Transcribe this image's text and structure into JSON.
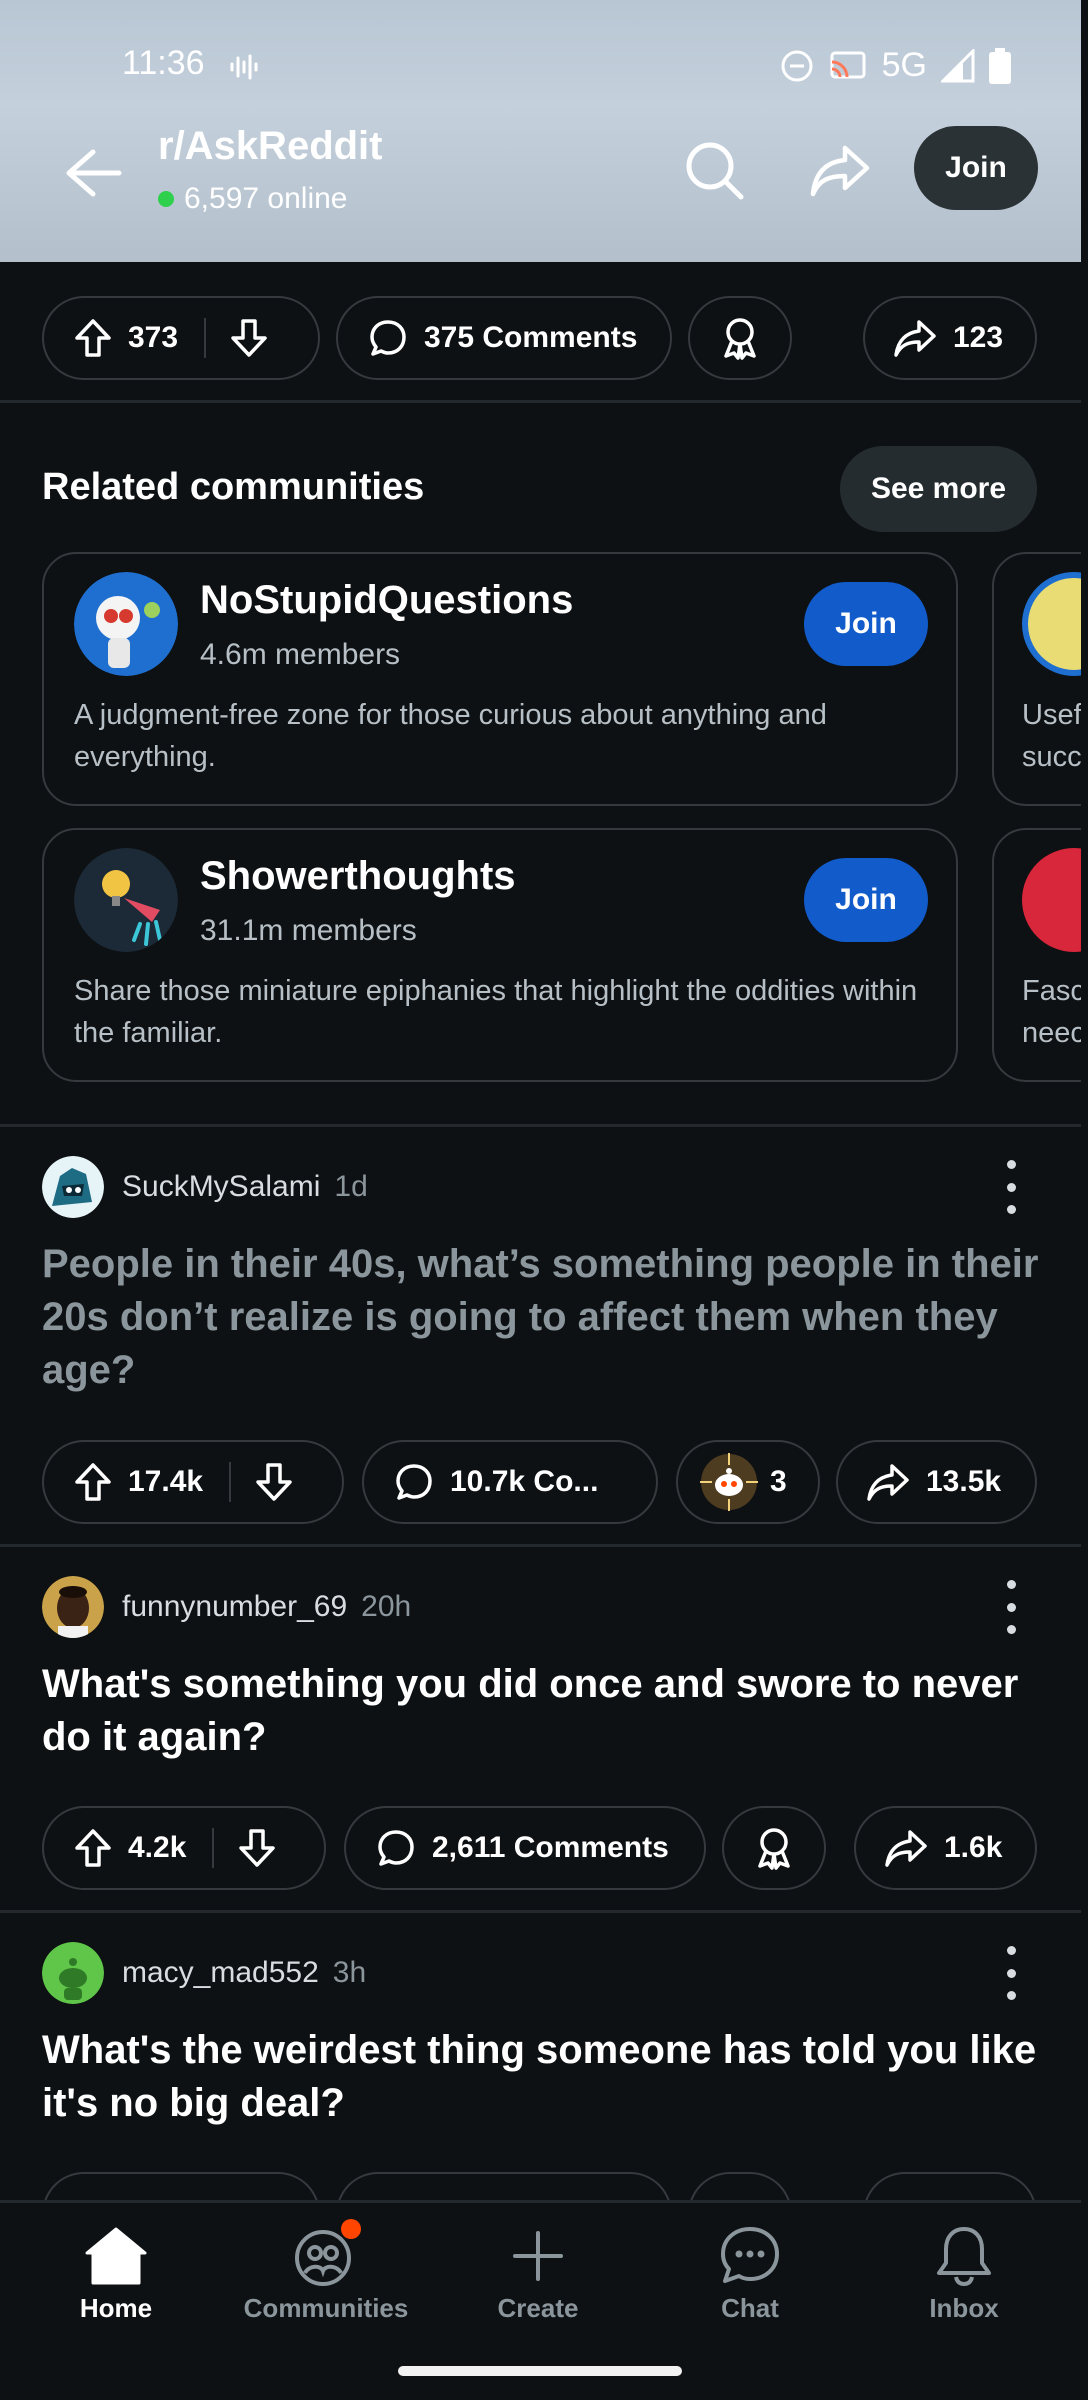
{
  "status_bar": {
    "time": "11:36",
    "network": "5G"
  },
  "header": {
    "subreddit": "r/AskReddit",
    "online": "6,597 online",
    "join_label": "Join"
  },
  "post_actions": {
    "votes": "373",
    "comments": "375 Comments",
    "shares": "123"
  },
  "related": {
    "title": "Related communities",
    "see_more": "See more",
    "cards": [
      {
        "name": "NoStupidQuestions",
        "members": "4.6m members",
        "description": "A judgment-free zone for those curious about anything and everything.",
        "join_label": "Join",
        "peek_text": "Usef\nsucc"
      },
      {
        "name": "Showerthoughts",
        "members": "31.1m members",
        "description": "Share those miniature epiphanies that highlight the oddities within the familiar.",
        "join_label": "Join",
        "peek_text": "Fasc\nneec"
      }
    ]
  },
  "posts": [
    {
      "user": "SuckMySalami",
      "age": "1d",
      "title": "People in their 40s, what’s something people in their 20s don’t realize is going to affect them when they age?",
      "votes": "17.4k",
      "comments": "10.7k Co...",
      "awards": "3",
      "shares": "13.5k",
      "read": true
    },
    {
      "user": "funnynumber_69",
      "age": "20h",
      "title": "What's something you did once and swore to never do it again?",
      "votes": "4.2k",
      "comments": "2,611 Comments",
      "shares": "1.6k",
      "read": false
    },
    {
      "user": "macy_mad552",
      "age": "3h",
      "title": "What's the weirdest thing someone has told you like it's no big deal?",
      "read": false
    }
  ],
  "bottom_nav": [
    {
      "label": "Home",
      "icon": "home-icon",
      "active": true
    },
    {
      "label": "Communities",
      "icon": "communities-icon",
      "active": false,
      "badge": true
    },
    {
      "label": "Create",
      "icon": "plus-icon",
      "active": false
    },
    {
      "label": "Chat",
      "icon": "chat-icon",
      "active": false
    },
    {
      "label": "Inbox",
      "icon": "bell-icon",
      "active": false
    }
  ],
  "colors": {
    "background": "#0e1113",
    "join_blue": "#115bca",
    "online_green": "#2fd04c",
    "badge_orange": "#ff4500"
  }
}
